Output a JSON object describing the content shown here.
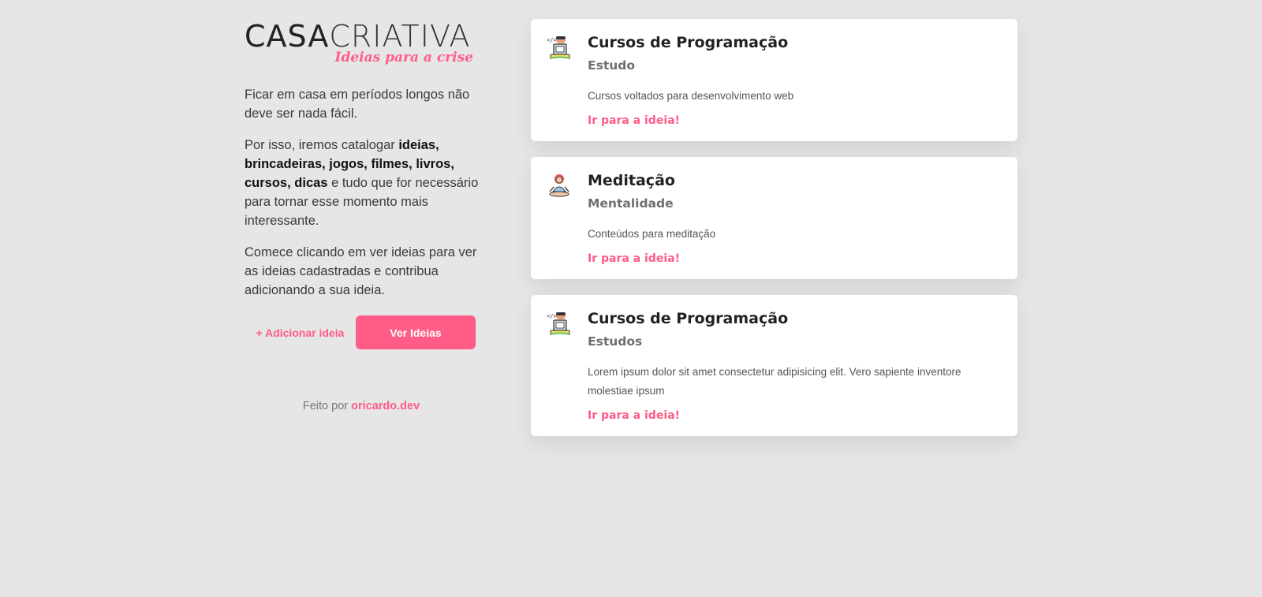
{
  "brand": {
    "logo_part1": "CASA",
    "logo_part2": "CRIATIVA",
    "tagline": "Ideias para a crise",
    "accent_color": "#ff5c87"
  },
  "intro": {
    "p1": "Ficar em casa em períodos longos não deve ser nada fácil.",
    "p2_prefix": "Por isso, iremos catalogar ",
    "p2_bold": "ideias, brincadeiras, jogos, filmes, livros, cursos, dicas",
    "p2_suffix": " e tudo que for necessário para tornar esse momento mais interessante.",
    "p3": "Comece clicando em ver ideias para ver as ideias cadastradas e contribua adicionando a sua ideia."
  },
  "actions": {
    "add_label": "+ Adicionar ideia",
    "view_label": "Ver Ideias"
  },
  "credits": {
    "prefix": "Feito por ",
    "author": "oricardo.dev"
  },
  "cards": [
    {
      "icon": "programmer-icon",
      "title": "Cursos de Programação",
      "category": "Estudo",
      "description": "Cursos voltados para desenvolvimento web",
      "link": "Ir para a ideia!"
    },
    {
      "icon": "meditation-icon",
      "title": "Meditação",
      "category": "Mentalidade",
      "description": "Conteúdos para meditação",
      "link": "Ir para a ideia!"
    },
    {
      "icon": "programmer-icon",
      "title": "Cursos de Programação",
      "category": "Estudos",
      "description": "Lorem ipsum dolor sit amet consectetur adipisicing elit. Vero sapiente inventore molestiae ipsum",
      "link": "Ir para a ideia!"
    }
  ]
}
